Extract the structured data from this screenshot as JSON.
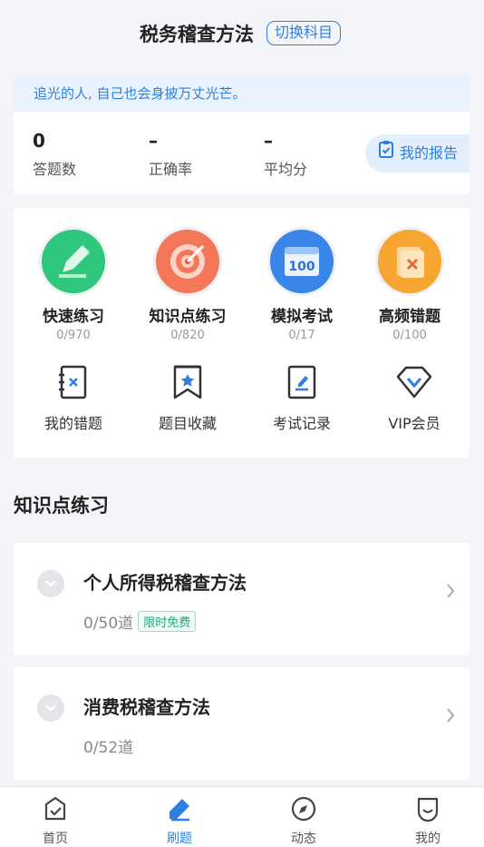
{
  "header": {
    "title": "税务稽查方法",
    "switch_label": "切换科目"
  },
  "motto": "追光的人, 自己也会身披万丈光芒。",
  "stats": [
    {
      "value": "0",
      "label": "答题数"
    },
    {
      "value": "–",
      "label": "正确率"
    },
    {
      "value": "–",
      "label": "平均分"
    }
  ],
  "report_label": "我的报告",
  "practice_modes": [
    {
      "label": "快速练习",
      "sub": "0/970",
      "icon": "pencil-icon",
      "color": "#2fc77b"
    },
    {
      "label": "知识点练习",
      "sub": "0/820",
      "icon": "target-icon",
      "color": "#f4775a"
    },
    {
      "label": "模拟考试",
      "sub": "0/17",
      "icon": "calendar-100-icon",
      "color": "#3a86e8"
    },
    {
      "label": "高频错题",
      "sub": "0/100",
      "icon": "error-card-icon",
      "color": "#f7a531"
    }
  ],
  "tools": [
    {
      "label": "我的错题",
      "icon": "wrong-notebook-icon"
    },
    {
      "label": "题目收藏",
      "icon": "bookmark-star-icon"
    },
    {
      "label": "考试记录",
      "icon": "exam-record-icon"
    },
    {
      "label": "VIP会员",
      "icon": "vip-diamond-icon"
    }
  ],
  "section_title": "知识点练习",
  "topics": [
    {
      "name": "个人所得税稽查方法",
      "count": "0/50道",
      "badge": "限时免费"
    },
    {
      "name": "消费税稽查方法",
      "count": "0/52道"
    }
  ],
  "tabs": [
    {
      "label": "首页",
      "icon": "home-icon",
      "active": false
    },
    {
      "label": "刷题",
      "icon": "practice-icon",
      "active": true
    },
    {
      "label": "动态",
      "icon": "compass-icon",
      "active": false
    },
    {
      "label": "我的",
      "icon": "profile-icon",
      "active": false
    }
  ],
  "colors": {
    "accent": "#2f7fe0",
    "badge_green": "#1fa776"
  }
}
